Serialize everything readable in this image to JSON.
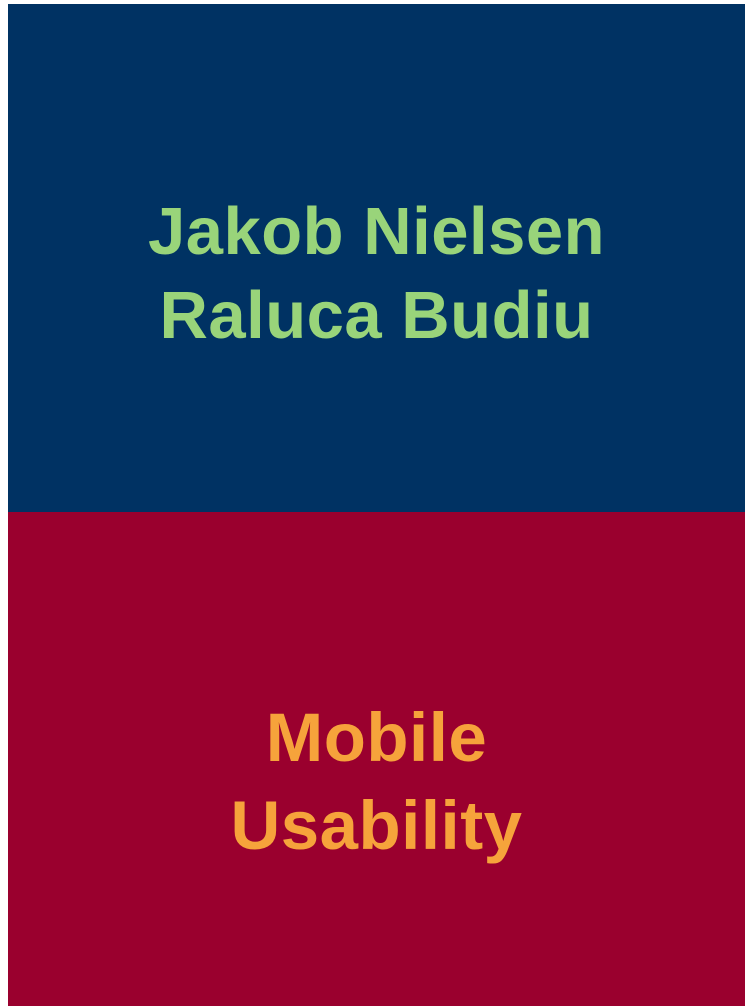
{
  "cover": {
    "authors": [
      "Jakob Nielsen",
      "Raluca Budiu"
    ],
    "title_lines": [
      "Mobile",
      "Usability"
    ],
    "colors": {
      "top_background": "#003263",
      "bottom_background": "#9a002e",
      "author_text": "#99d47a",
      "title_text": "#f6a33b"
    }
  }
}
